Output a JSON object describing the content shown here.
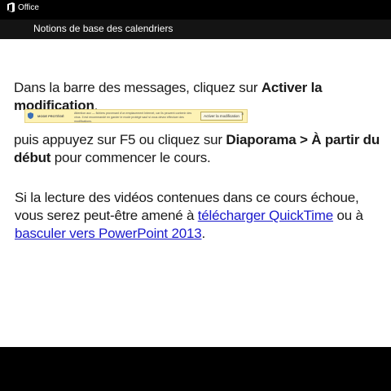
{
  "header": {
    "brand": "Office",
    "course_title": "Notions de base des calendriers"
  },
  "slide": {
    "p1_text": "Dans la barre des messages, cliquez sur ",
    "p1_bold": "Activer la modification",
    "p1_end": ",",
    "message_bar": {
      "mode_label": "MODE PROTÉGÉ",
      "text": "Attention aux — fichiers provenant d'un emplacement Internet, car ils peuvent contenir des virus. Il est recommandé en garder le mode protégé sauf si vous devez effectuer des modifications.",
      "enable_button": "Activer la modification",
      "close": "×"
    },
    "p2_text": "puis appuyez sur F5 ou cliquez sur ",
    "p2_bold": "Diaporama > À partir du début",
    "p2_end": " pour commencer le cours.",
    "p3_text": "Si la lecture des vidéos contenues dans ce cours échoue, vous serez peut-être amené à ",
    "p3_link1": "télécharger QuickTime",
    "p3_mid": " ou à ",
    "p3_link2": "basculer vers PowerPoint 2013",
    "p3_end": "."
  },
  "colors": {
    "bar": "#000000",
    "link": "#1a1acc",
    "message_bar": "#fdf2b5"
  }
}
